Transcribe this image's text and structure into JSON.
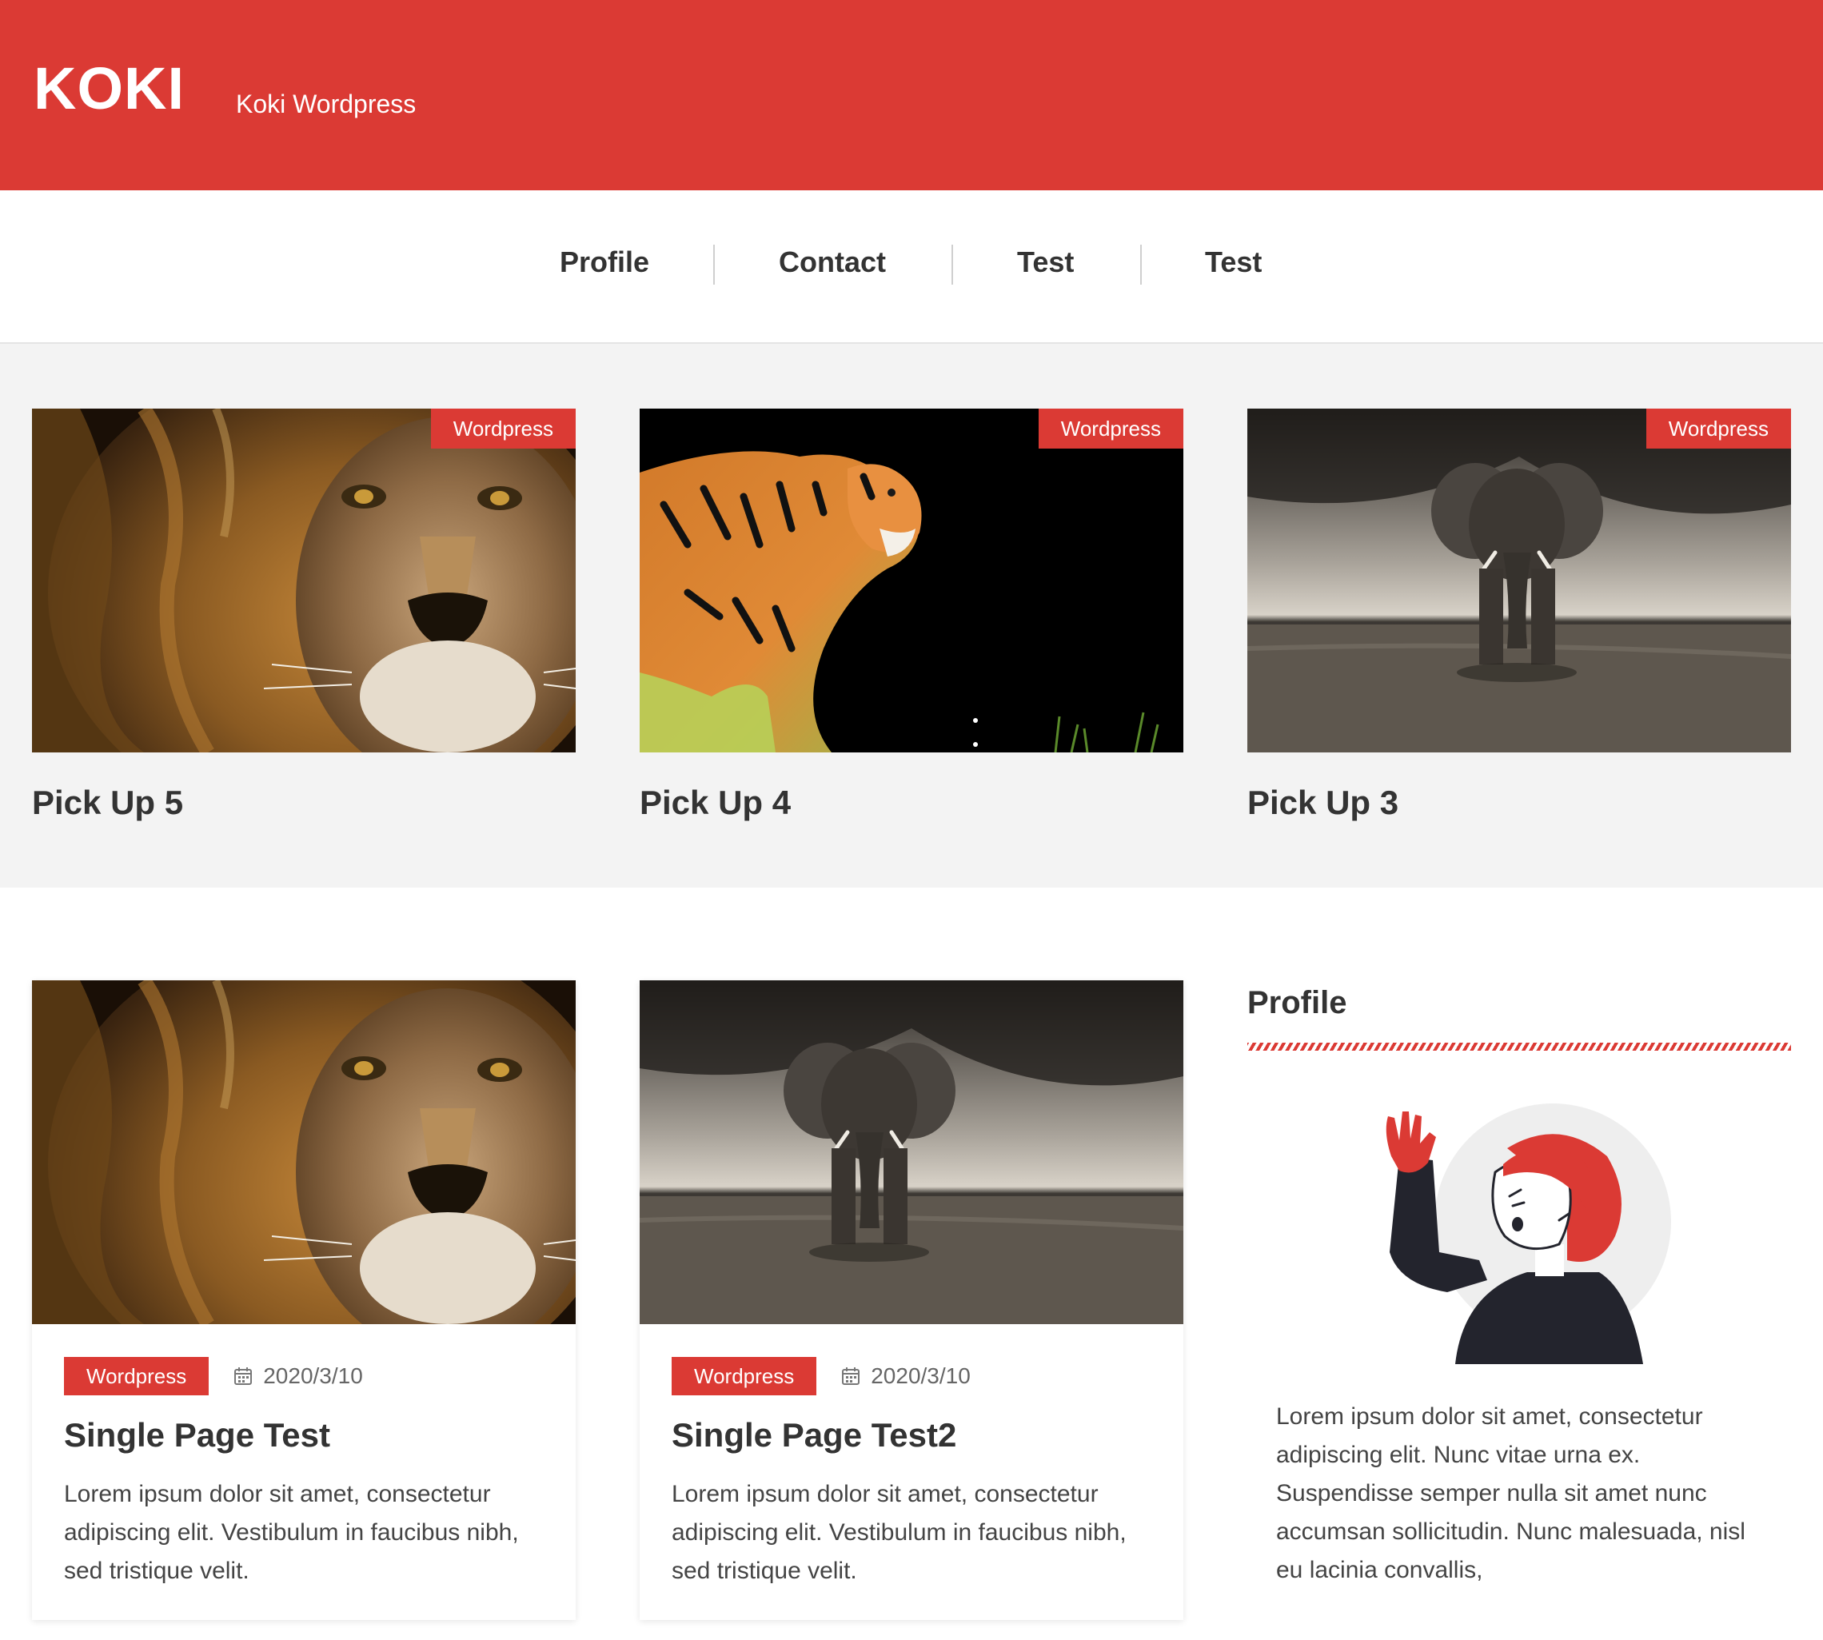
{
  "header": {
    "logo": "KOKI",
    "tagline": "Koki Wordpress",
    "background_color": "#db3a34"
  },
  "nav": {
    "items": [
      {
        "label": "Profile"
      },
      {
        "label": "Contact"
      },
      {
        "label": "Test"
      },
      {
        "label": "Test"
      }
    ]
  },
  "pickups": [
    {
      "title": "Pick Up 5",
      "category": "Wordpress",
      "image": "lion-photo"
    },
    {
      "title": "Pick Up 4",
      "category": "Wordpress",
      "image": "tiger-photo"
    },
    {
      "title": "Pick Up 3",
      "category": "Wordpress",
      "image": "elephant-photo"
    }
  ],
  "posts": [
    {
      "title": "Single Page Test",
      "category": "Wordpress",
      "date": "2020/3/10",
      "excerpt": "Lorem ipsum dolor sit amet, consectetur adipiscing elit. Vestibulum in faucibus nibh, sed tristique velit.",
      "image": "lion-photo"
    },
    {
      "title": "Single Page Test2",
      "category": "Wordpress",
      "date": "2020/3/10",
      "excerpt": "Lorem ipsum dolor sit amet, consectetur adipiscing elit. Vestibulum in faucibus nibh, sed tristique velit.",
      "image": "elephant-photo"
    }
  ],
  "sidebar": {
    "widget_title": "Profile",
    "profile_text": "Lorem ipsum dolor sit amet, consectetur adipiscing elit. Nunc vitae urna ex. Suspendisse semper nulla sit amet nunc accumsan sollicitudin. Nunc malesuada, nisl eu lacinia convallis,",
    "avatar": "waving-woman-illustration"
  },
  "colors": {
    "accent": "#db3a34",
    "pickup_background": "#f3f3f3",
    "text": "#333333"
  }
}
